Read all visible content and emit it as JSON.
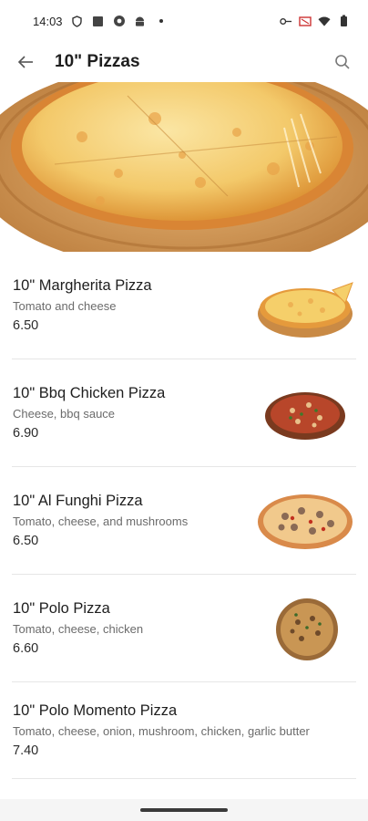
{
  "status_bar": {
    "time": "14:03",
    "left_icons": [
      "shield-icon",
      "square-app-icon",
      "gear-app-icon",
      "android-icon",
      "dot-icon"
    ],
    "right_icons": [
      "key-icon",
      "screen-icon",
      "wifi-icon",
      "battery-icon"
    ]
  },
  "app_bar": {
    "title": "10\" Pizzas",
    "back_icon": "arrow-left-icon",
    "search_icon": "search-icon"
  },
  "menu": {
    "items": [
      {
        "name": "10\" Margherita Pizza",
        "description": "Tomato and cheese",
        "price": "6.50"
      },
      {
        "name": "10\" Bbq Chicken Pizza",
        "description": "Cheese, bbq sauce",
        "price": "6.90"
      },
      {
        "name": "10\" Al Funghi Pizza",
        "description": "Tomato, cheese, and mushrooms",
        "price": "6.50"
      },
      {
        "name": "10\" Polo Pizza",
        "description": "Tomato, cheese, chicken",
        "price": "6.60"
      },
      {
        "name": "10\" Polo Momento Pizza",
        "description": "Tomato, cheese, onion, mushroom, chicken, garlic butter",
        "price": "7.40"
      }
    ]
  }
}
